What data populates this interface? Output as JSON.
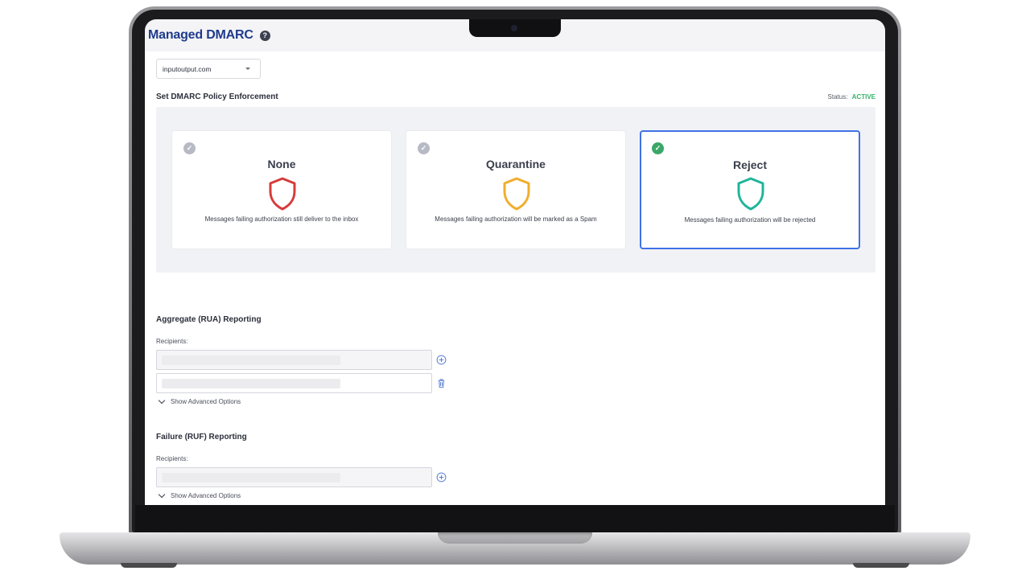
{
  "app": {
    "title": "Managed DMARC",
    "help_glyph": "?"
  },
  "domain_select": {
    "value": "inputoutput.com"
  },
  "policy": {
    "heading": "Set DMARC Policy Enforcement",
    "status_label": "Status:",
    "status_value": "ACTIVE",
    "status_color": "#33b36b",
    "options": [
      {
        "name": "None",
        "description": "Messages failing authorization still deliver to the inbox",
        "shield_color": "#d63b3b",
        "selected": false
      },
      {
        "name": "Quarantine",
        "description": "Messages failing authorization will be marked as a Spam",
        "shield_color": "#f2ad2b",
        "selected": false
      },
      {
        "name": "Reject",
        "description": "Messages failing authorization will be rejected",
        "shield_color": "#1fb59a",
        "selected": true
      }
    ],
    "selected_border_color": "#3f72e6"
  },
  "aggregate": {
    "heading": "Aggregate (RUA) Reporting",
    "recipients_label": "Recipients:",
    "advanced_label": "Show Advanced Options",
    "add_icon": "plus-circle-icon",
    "delete_icon": "trash-icon"
  },
  "failure": {
    "heading": "Failure (RUF) Reporting",
    "recipients_label": "Recipients:",
    "advanced_label": "Show Advanced Options",
    "add_icon": "plus-circle-icon"
  }
}
